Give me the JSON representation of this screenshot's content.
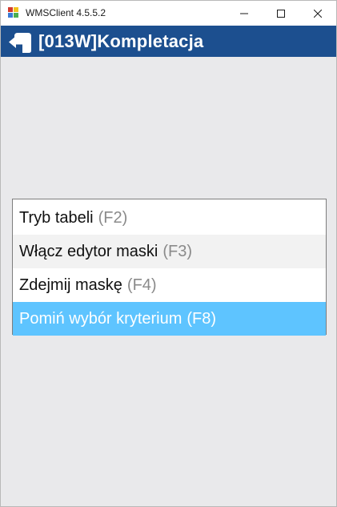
{
  "window": {
    "title": "WMSClient 4.5.5.2",
    "icon": "app-icon",
    "controls": {
      "minimize": "minimize-icon",
      "maximize": "maximize-icon",
      "close": "close-icon"
    }
  },
  "header": {
    "title": "[013W]Kompletacja",
    "back_icon": "back-arrow-icon",
    "background_color": "#1c4f8f"
  },
  "menu": {
    "items": [
      {
        "label": "Tryb tabeli",
        "shortcut": "(F2)",
        "selected": false
      },
      {
        "label": "Włącz edytor maski",
        "shortcut": "(F3)",
        "selected": false
      },
      {
        "label": "Zdejmij maskę",
        "shortcut": "(F4)",
        "selected": false
      },
      {
        "label": "Pomiń wybór kryterium",
        "shortcut": "(F8)",
        "selected": true
      }
    ],
    "selected_color": "#5ec4ff"
  }
}
